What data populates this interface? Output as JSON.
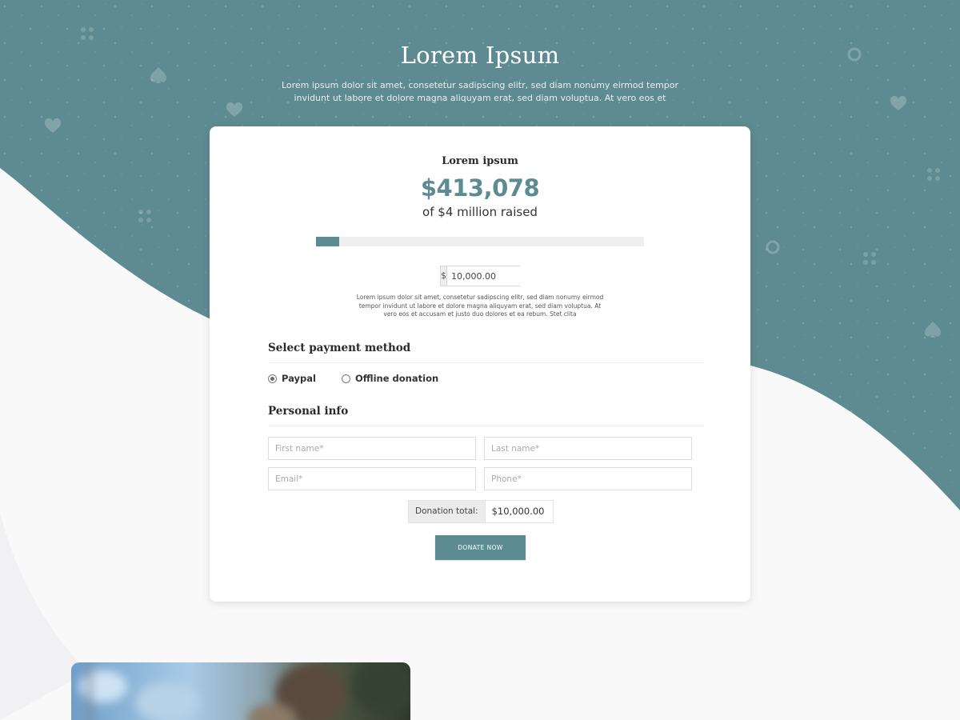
{
  "colors": {
    "accent": "#5c8c92",
    "hero_background": "#5e8b91",
    "page_background": "#f9f9fa"
  },
  "hero": {
    "title": "Lorem Ipsum",
    "subtitle": "Lorem ipsum dolor sit amet, consetetur sadipscing elitr, sed diam nonumy eirmod tempor invidunt ut labore et dolore magna aliquyam erat, sed diam voluptua. At vero eos et"
  },
  "card": {
    "campaign_name": "Lorem ipsum",
    "raised_amount": "$413,078",
    "raised_goal": "of $4 million raised",
    "progress_fraction": 0.07,
    "amount": {
      "currency_symbol": "$",
      "value": "10,000.00"
    },
    "description": "Lorem ipsum dolor sit amet, consetetur sadipscing elitr, sed diam nonumy eirmod tempor invidunt ut labore et dolore magna aliquyam erat, sed diam voluptua. At vero eos et accusam et justo duo dolores et ea rebum. Stet clita",
    "payment": {
      "heading": "Select payment method",
      "options": [
        {
          "label": "Paypal",
          "selected": true
        },
        {
          "label": "Offline donation",
          "selected": false
        }
      ]
    },
    "personal_info": {
      "heading": "Personal info",
      "first_name_placeholder": "First name*",
      "last_name_placeholder": "Last name*",
      "email_placeholder": "Email*",
      "phone_placeholder": "Phone*"
    },
    "total": {
      "label": "Donation total:",
      "value": "$10,000.00"
    },
    "donate_button_label": "DONATE NOW"
  }
}
